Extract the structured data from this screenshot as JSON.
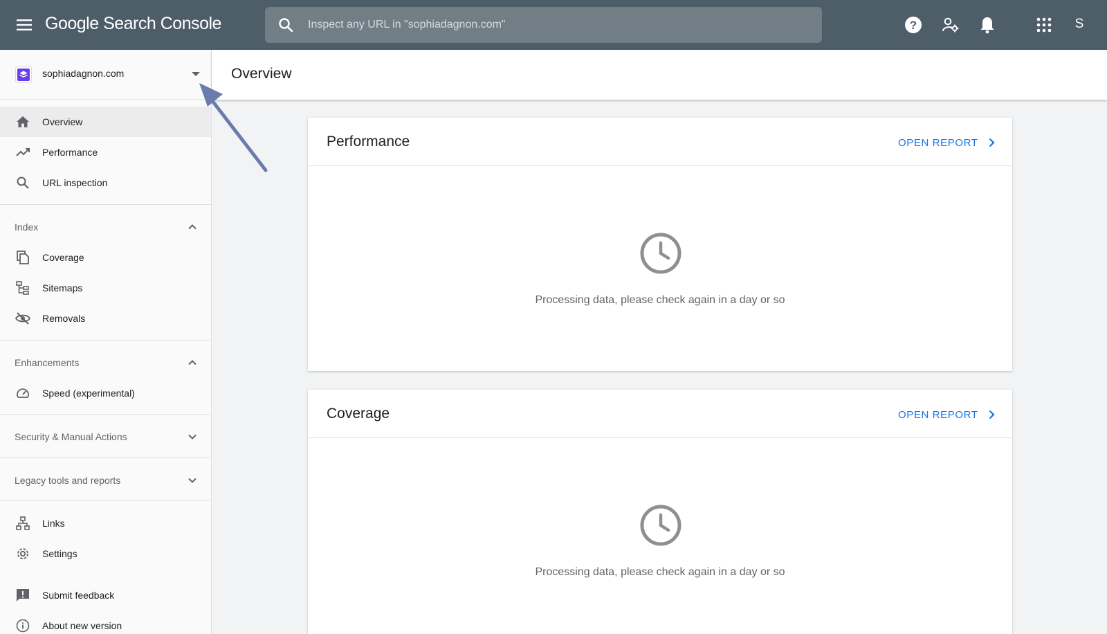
{
  "app": {
    "brand_google": "Google",
    "brand_product": "Search Console",
    "search_placeholder": "Inspect any URL in \"sophiadagnon.com\"",
    "user_initial": "S"
  },
  "property": {
    "name": "sophiadagnon.com"
  },
  "sidebar": {
    "primary": [
      {
        "label": "Overview",
        "icon": "home-icon",
        "active": true
      },
      {
        "label": "Performance",
        "icon": "trending-up-icon"
      },
      {
        "label": "URL inspection",
        "icon": "search-icon"
      }
    ],
    "index": {
      "title": "Index",
      "expanded": true,
      "items": [
        {
          "label": "Coverage",
          "icon": "coverage-icon"
        },
        {
          "label": "Sitemaps",
          "icon": "sitemap-icon"
        },
        {
          "label": "Removals",
          "icon": "removals-icon"
        }
      ]
    },
    "enhancements": {
      "title": "Enhancements",
      "expanded": true,
      "items": [
        {
          "label": "Speed (experimental)",
          "icon": "speed-icon"
        }
      ]
    },
    "security": {
      "title": "Security & Manual Actions",
      "expanded": false
    },
    "legacy": {
      "title": "Legacy tools and reports",
      "expanded": false
    },
    "bottom": [
      {
        "label": "Links",
        "icon": "links-icon"
      },
      {
        "label": "Settings",
        "icon": "settings-icon"
      }
    ],
    "footer": [
      {
        "label": "Submit feedback",
        "icon": "feedback-icon"
      },
      {
        "label": "About new version",
        "icon": "info-icon"
      }
    ]
  },
  "main": {
    "title": "Overview",
    "cards": [
      {
        "title": "Performance",
        "action": "OPEN REPORT",
        "message": "Processing data, please check again in a day or so"
      },
      {
        "title": "Coverage",
        "action": "OPEN REPORT",
        "message": "Processing data, please check again in a day or so"
      }
    ]
  },
  "colors": {
    "topbar": "#4e5e69",
    "search_bg": "#727e86",
    "link_blue": "#1a73e8",
    "annotation_arrow": "#6b7bab"
  }
}
